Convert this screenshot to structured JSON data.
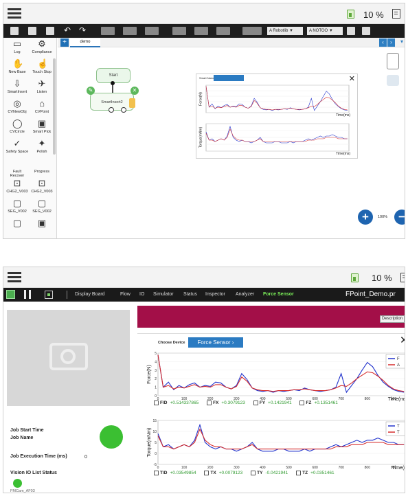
{
  "status": {
    "battery_label": "10 %"
  },
  "screenA": {
    "toolbar": {
      "select1": "A Robotlib ▼",
      "select2": "A NOTOO ▼"
    },
    "palette": [
      {
        "label": "Log",
        "icon": "▭"
      },
      {
        "label": "Compliance",
        "icon": "⚙"
      },
      {
        "label": "New Base",
        "icon": "✋"
      },
      {
        "label": "Touch Stop",
        "icon": "☝"
      },
      {
        "label": "SmartInsert",
        "icon": "⇩"
      },
      {
        "label": "Listen",
        "icon": "✈"
      },
      {
        "label": "CVNewObj",
        "icon": "◎"
      },
      {
        "label": "CVPoint",
        "icon": "⌂"
      },
      {
        "label": "CVCircle",
        "icon": "◯"
      },
      {
        "label": "Smart Pick",
        "icon": "▣"
      },
      {
        "label": "Safety Space",
        "icon": "✓"
      },
      {
        "label": "Polish",
        "icon": "✦"
      },
      {
        "label": "Fault Recover",
        "icon": ""
      },
      {
        "label": "Progress",
        "icon": ""
      },
      {
        "label": "CHG2_V003",
        "icon": "⊡"
      },
      {
        "label": "CHG2_V003",
        "icon": "⊡"
      },
      {
        "label": "SEG_V002",
        "icon": "▢"
      },
      {
        "label": "SEG_V002",
        "icon": "▢"
      },
      {
        "label": "",
        "icon": "▢"
      },
      {
        "label": "",
        "icon": "▣"
      }
    ],
    "tab_label": "demo",
    "nodes": {
      "start": "Start",
      "smartinsert": "SmartInsert2"
    },
    "zoom_value": "100%",
    "mini_panel": {
      "device_label": "Smart Nano",
      "force_axis": "Force(N)",
      "torque_axis": "Torque(mNm)",
      "time_label": "Time(ms)"
    }
  },
  "screenB": {
    "menu": [
      "Display Board",
      "Flow",
      "IO",
      "Simulator",
      "Status",
      "Inspector",
      "Analyzer",
      "Force Sensor"
    ],
    "active_menu": "Force Sensor",
    "project": "FPoint_Demo.pr",
    "job": {
      "start_time_label": "Job Start Time",
      "name_label": "Job Name",
      "exec_label": "Job Execution Time (ms)",
      "exec_value": "0",
      "vision_label": "Vision IO List Status",
      "camera_name": "FMCam_AF03"
    },
    "description_btn": "Description",
    "choose_device_label": "Choose Device",
    "device_btn": "Force Sensor  ›",
    "force_chart": {
      "ylabel": "Force(N)",
      "xlabel": "Time(ms)",
      "legend": [
        {
          "name": "F",
          "color": "#2233cc"
        },
        {
          "name": "A",
          "color": "#d62d2d"
        }
      ],
      "readouts": [
        {
          "key": "F/D",
          "value": "+0.514337865"
        },
        {
          "key": "FX",
          "value": "+0.3079123"
        },
        {
          "key": "FY",
          "value": "+0.1421941"
        },
        {
          "key": "FZ",
          "value": "+0.1351461"
        }
      ]
    },
    "torque_chart": {
      "ylabel": "Torque(mNm)",
      "xlabel": "Time(m",
      "legend": [
        {
          "name": "T",
          "color": "#2233cc"
        },
        {
          "name": "T",
          "color": "#d62d2d"
        }
      ],
      "readouts": [
        {
          "key": "T/D",
          "value": "+0.03549854"
        },
        {
          "key": "TX",
          "value": "+0.0079123"
        },
        {
          "key": "TY",
          "value": "-0.0421941"
        },
        {
          "key": "TZ",
          "value": "+0.0351461"
        }
      ]
    }
  },
  "chart_data": [
    {
      "type": "line",
      "title": "",
      "ylabel": "Force(N)",
      "xlabel": "Time(ms)",
      "x_ticks": [
        0,
        100,
        200,
        300,
        400,
        500,
        600,
        700,
        800,
        900
      ],
      "y_ticks": [
        0,
        1,
        2,
        3,
        4,
        5
      ],
      "ylim": [
        0,
        5
      ],
      "xlim": [
        0,
        950
      ],
      "series": [
        {
          "color": "#2233cc",
          "x": [
            0,
            20,
            40,
            60,
            80,
            100,
            120,
            140,
            160,
            180,
            200,
            220,
            240,
            260,
            280,
            300,
            320,
            340,
            360,
            380,
            400,
            420,
            440,
            460,
            480,
            500,
            520,
            540,
            560,
            580,
            600,
            620,
            640,
            660,
            680,
            700,
            720,
            740,
            760,
            780,
            800,
            820,
            840,
            860,
            880,
            900,
            920,
            940
          ],
          "values": [
            4.8,
            1.0,
            1.6,
            0.7,
            1.2,
            0.9,
            1.3,
            1.5,
            1.0,
            1.2,
            1.1,
            1.6,
            1.5,
            1.0,
            0.8,
            1.2,
            2.6,
            1.9,
            0.9,
            0.6,
            0.5,
            0.6,
            0.4,
            0.6,
            0.5,
            0.6,
            0.7,
            0.6,
            0.9,
            0.7,
            0.6,
            0.5,
            0.6,
            0.7,
            1.0,
            2.6,
            0.4,
            1.2,
            2.0,
            3.0,
            3.9,
            3.4,
            2.4,
            1.6,
            1.1,
            0.7,
            0.5,
            0.4
          ]
        },
        {
          "color": "#d62d2d",
          "x": [
            0,
            20,
            40,
            60,
            80,
            100,
            120,
            140,
            160,
            180,
            200,
            220,
            240,
            260,
            280,
            300,
            320,
            340,
            360,
            380,
            400,
            420,
            440,
            460,
            480,
            500,
            520,
            540,
            560,
            580,
            600,
            620,
            640,
            660,
            680,
            700,
            720,
            740,
            760,
            780,
            800,
            820,
            840,
            860,
            880,
            900,
            920,
            940
          ],
          "values": [
            4.8,
            1.0,
            1.2,
            0.8,
            1.0,
            0.9,
            1.1,
            1.3,
            1.0,
            1.1,
            1.0,
            1.3,
            1.3,
            1.0,
            0.8,
            1.1,
            2.2,
            1.7,
            0.9,
            0.7,
            0.6,
            0.6,
            0.5,
            0.6,
            0.6,
            0.6,
            0.7,
            0.7,
            0.8,
            0.7,
            0.6,
            0.6,
            0.6,
            0.7,
            0.9,
            1.2,
            1.1,
            1.5,
            2.0,
            2.4,
            2.8,
            2.7,
            2.3,
            1.8,
            1.2,
            0.8,
            0.6,
            0.5
          ]
        }
      ]
    },
    {
      "type": "line",
      "title": "",
      "ylabel": "Torque(mNm)",
      "xlabel": "Time(m",
      "x_ticks": [
        0,
        100,
        200,
        300,
        400,
        500,
        600,
        700,
        800,
        900
      ],
      "y_ticks": [
        -5,
        0,
        5,
        10,
        15
      ],
      "ylim": [
        -5,
        15
      ],
      "xlim": [
        0,
        950
      ],
      "series": [
        {
          "color": "#2233cc",
          "x": [
            0,
            20,
            40,
            60,
            80,
            100,
            120,
            140,
            160,
            180,
            200,
            220,
            240,
            260,
            280,
            300,
            320,
            340,
            360,
            380,
            400,
            420,
            440,
            460,
            480,
            500,
            520,
            540,
            560,
            580,
            600,
            620,
            640,
            660,
            680,
            700,
            720,
            740,
            760,
            780,
            800,
            820,
            840,
            860,
            880,
            900,
            920,
            940
          ],
          "values": [
            9,
            3,
            4,
            2,
            3,
            4,
            3,
            6,
            13,
            5,
            3,
            2,
            3,
            2,
            2,
            1,
            2,
            3,
            5,
            2,
            1,
            1,
            1,
            2,
            2,
            1,
            1,
            1,
            2,
            1,
            2,
            2,
            2,
            3,
            4,
            3,
            4,
            5,
            6,
            5,
            6,
            6,
            7,
            6,
            5,
            5,
            4,
            4
          ]
        },
        {
          "color": "#d62d2d",
          "x": [
            0,
            20,
            40,
            60,
            80,
            100,
            120,
            140,
            160,
            180,
            200,
            220,
            240,
            260,
            280,
            300,
            320,
            340,
            360,
            380,
            400,
            420,
            440,
            460,
            480,
            500,
            520,
            540,
            560,
            580,
            600,
            620,
            640,
            660,
            680,
            700,
            720,
            740,
            760,
            780,
            800,
            820,
            840,
            860,
            880,
            900,
            920,
            940
          ],
          "values": [
            8,
            3,
            3,
            2,
            3,
            4,
            3,
            5,
            11,
            6,
            4,
            3,
            3,
            2,
            2,
            2,
            2,
            3,
            4,
            2,
            2,
            2,
            2,
            2,
            2,
            2,
            2,
            2,
            2,
            2,
            2,
            2,
            2,
            2,
            3,
            3,
            3,
            4,
            4,
            4,
            5,
            5,
            5,
            5,
            4,
            4,
            4,
            4
          ]
        }
      ]
    }
  ]
}
